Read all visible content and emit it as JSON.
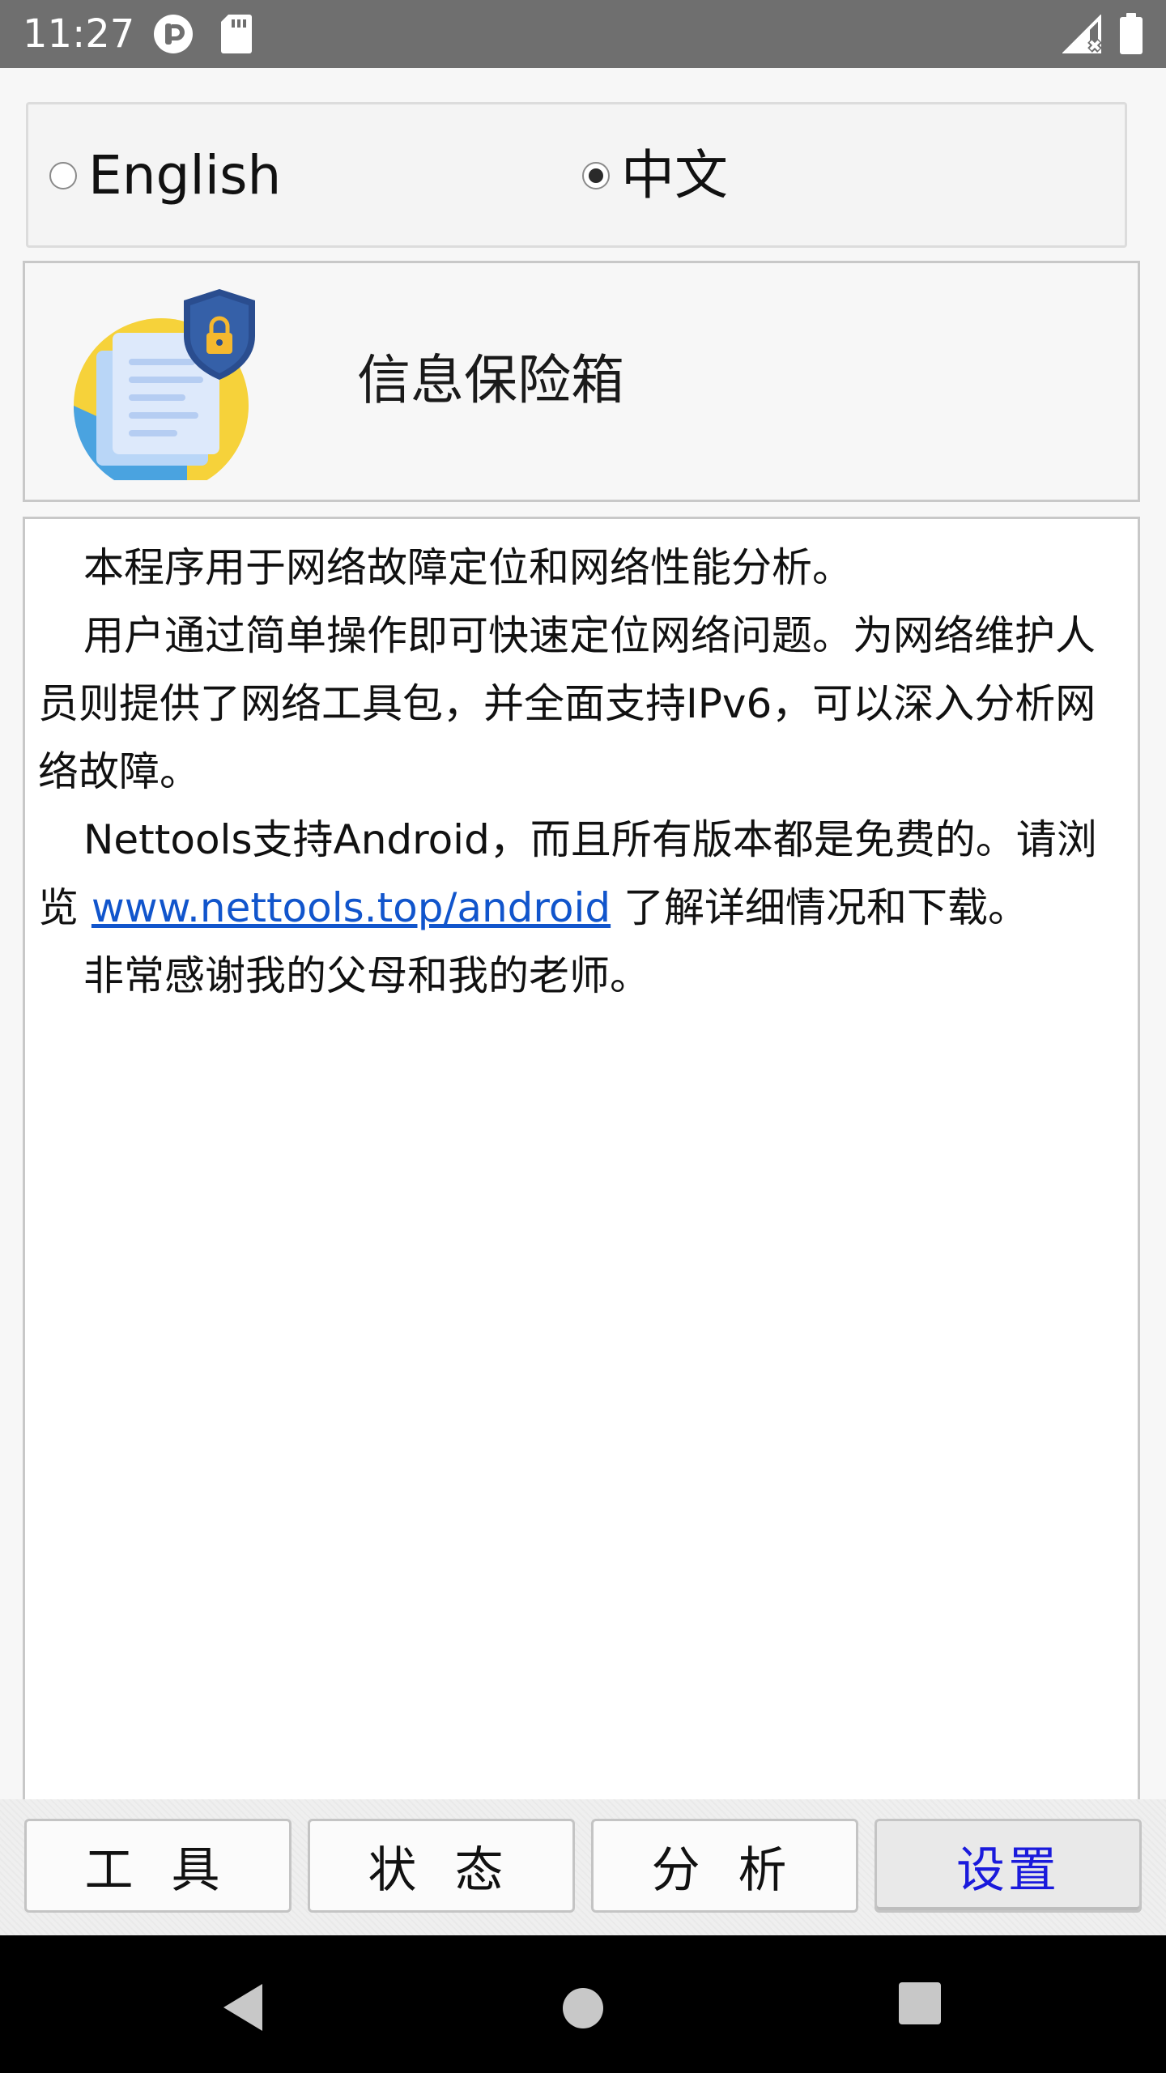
{
  "status_bar": {
    "time": "11:27",
    "icons": [
      "app-notification-icon",
      "sd-card-icon",
      "signal-no-data-icon",
      "battery-full-icon"
    ]
  },
  "language": {
    "options": [
      {
        "label": "English",
        "selected": false
      },
      {
        "label": "中文",
        "selected": true
      }
    ]
  },
  "header": {
    "logo": "secure-document-shield-icon",
    "title": "信息保险箱"
  },
  "description": {
    "p1": "本程序用于网络故障定位和网络性能分析。",
    "p2": "用户通过简单操作即可快速定位网络问题。为网络维护人员则提供了网络工具包，并全面支持IPv6，可以深入分析网络故障。",
    "p3_before": "Nettools支持Android，而且所有版本都是免费的。请浏览 ",
    "p3_link": "www.nettools.top/android",
    "p3_after": " 了解详细情况和下载。",
    "p4": "非常感谢我的父母和我的老师。"
  },
  "tabs": {
    "tools": "工 具",
    "status": "状 态",
    "analysis": "分 析",
    "settings": "设置",
    "active": "settings"
  },
  "colors": {
    "status_bar": "#6f6f6f",
    "link": "#1155cc",
    "active_tab_text": "#1a1adc",
    "nav_bar": "#000000"
  }
}
